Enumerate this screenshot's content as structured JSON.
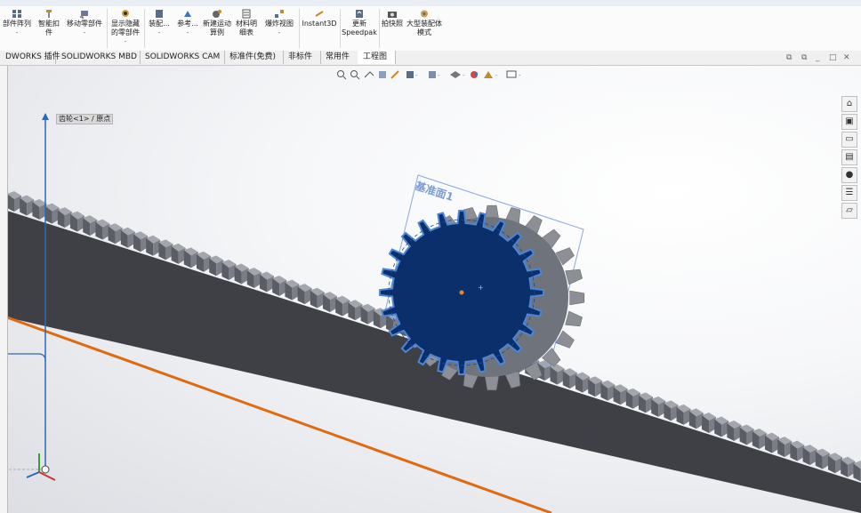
{
  "ribbon": {
    "buttons": [
      {
        "label": "部件阵列",
        "dd": "-"
      },
      {
        "label": "智能扣件",
        "dd": ""
      },
      {
        "label": "移动零部件",
        "dd": "-"
      },
      {
        "label": "显示隐藏的零部件",
        "dd": "-"
      },
      {
        "label": "装配...",
        "dd": "-"
      },
      {
        "label": "参考...",
        "dd": "-"
      },
      {
        "label": "新建运动算例",
        "dd": ""
      },
      {
        "label": "材料明细表",
        "dd": ""
      },
      {
        "label": "爆炸视图",
        "dd": "-"
      },
      {
        "label": "Instant3D",
        "dd": ""
      },
      {
        "label": "更新 Speedpak",
        "dd": ""
      },
      {
        "label": "拍快照",
        "dd": ""
      },
      {
        "label": "大型装配体模式",
        "dd": ""
      }
    ]
  },
  "tabs": [
    "DWORKS 插件",
    "SOLIDWORKS MBD",
    "SOLIDWORKS CAM",
    "标准件(免费)",
    "非标件",
    "常用件",
    "工程图"
  ],
  "viewport": {
    "origin_label": "齿轮<1> / 原点",
    "plane_label": "基准面1"
  },
  "taskpane": [
    "home-icon",
    "parts-icon",
    "folder-icon",
    "appearance-icon",
    "color-icon",
    "list-icon",
    "forum-icon"
  ],
  "colors": {
    "gear_face": "#0a2f6b",
    "gear_body": "#8c8f95",
    "rack_body": "#3f4046",
    "rack_edge": "#e06a10",
    "axis": "#2f67b3"
  }
}
